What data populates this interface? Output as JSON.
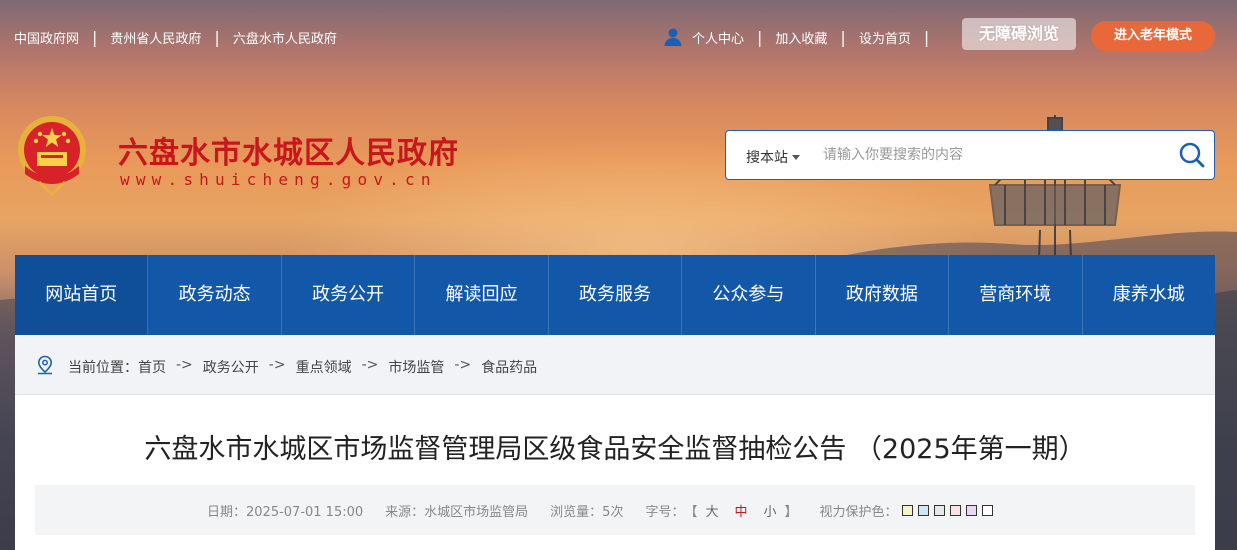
{
  "top_links": [
    "中国政府网",
    "贵州省人民政府",
    "六盘水市人民政府"
  ],
  "right_links": [
    "个人中心",
    "加入收藏",
    "设为首页"
  ],
  "accessibility_label": "无障碍浏览",
  "elder_mode_label": "进入老年模式",
  "site": {
    "title": "六盘水市水城区人民政府",
    "url": "www.shuicheng.gov.cn"
  },
  "search": {
    "scope": "搜本站",
    "placeholder": "请输入你要搜索的内容"
  },
  "nav": [
    "网站首页",
    "政务动态",
    "政务公开",
    "解读回应",
    "政务服务",
    "公众参与",
    "政府数据",
    "营商环境",
    "康养水城"
  ],
  "breadcrumb": {
    "label": "当前位置：",
    "items": [
      "首页",
      "政务公开",
      "重点领域",
      "市场监管",
      "食品药品"
    ],
    "arrow": "->"
  },
  "article": {
    "title": "六盘水市水城区市场监督管理局区级食品安全监督抽检公告 （2025年第一期）",
    "date": "日期：2025-07-01 15:00",
    "source": "来源：水城区市场监管局",
    "views": "浏览量：5次",
    "font_label": "字号：",
    "font_open": "【",
    "font_sizes": [
      "大",
      "中",
      "小"
    ],
    "font_close": "】",
    "eye_label": "视力保护色："
  },
  "colors": {
    "primary": "#1358a8",
    "brand_red": "#c8161d",
    "elder_button": "#e8683a",
    "eye_swatches": [
      "#f7f3c6",
      "#cfe6f5",
      "#e8e8e8",
      "#fbe0e6",
      "#ead8f2",
      "#ffffff"
    ]
  }
}
